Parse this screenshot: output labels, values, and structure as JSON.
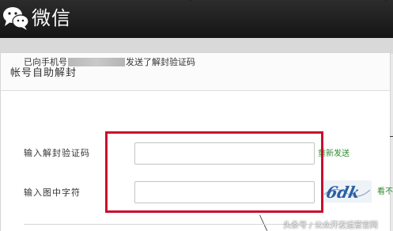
{
  "header": {
    "brand_name": "微信",
    "logo_icon": "wechat-logo-icon",
    "background": "#1e1e1e"
  },
  "page": {
    "title": "帐号自助解封"
  },
  "form": {
    "sent_prefix": "已向手机号",
    "sent_suffix": "发送了解封验证码",
    "code_label": "输入解封验证码",
    "code_value": "",
    "resend_link": "重新发送",
    "captcha_label": "输入图中字符",
    "captcha_value": "",
    "captcha_text": "6dk",
    "refresh_link": "看不"
  },
  "annotation": {
    "highlight_color": "#c8102e"
  },
  "watermark": {
    "text": "头条号 / 公众开发运营官网"
  },
  "colors": {
    "link_green": "#2e8b2e",
    "band_gray": "#d9d9d9"
  }
}
